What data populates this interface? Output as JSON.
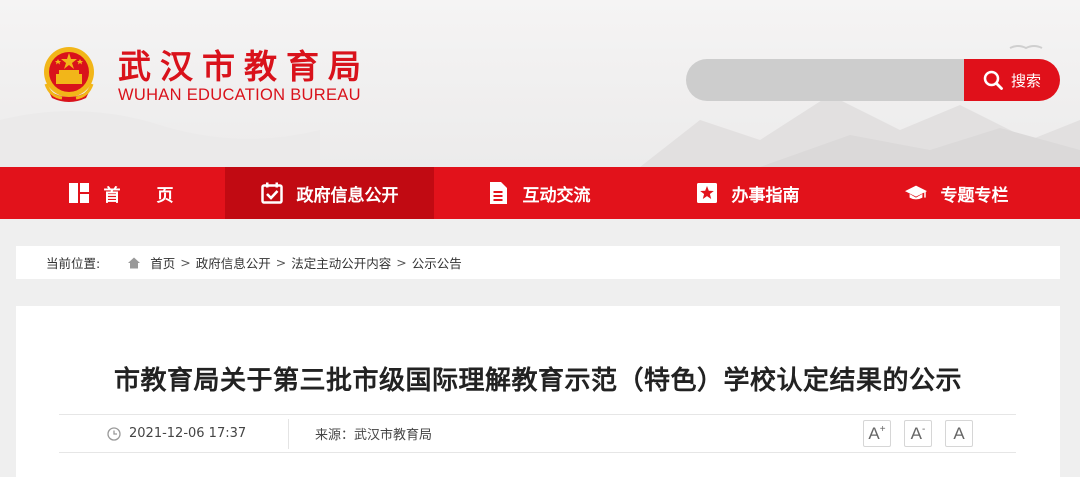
{
  "header": {
    "title": "武汉市教育局",
    "subtitle": "WUHAN EDUCATION BUREAU",
    "emblem": "national-emblem",
    "search": {
      "placeholder": "",
      "button_label": "搜索",
      "icon": "search-icon"
    }
  },
  "nav": {
    "items": [
      {
        "label": "首页",
        "icon": "home-grid-icon",
        "active": false
      },
      {
        "label": "政府信息公开",
        "icon": "calendar-check-icon",
        "active": true
      },
      {
        "label": "互动交流",
        "icon": "document-icon",
        "active": false
      },
      {
        "label": "办事指南",
        "icon": "star-bookmark-icon",
        "active": false
      },
      {
        "label": "专题专栏",
        "icon": "graduation-cap-icon",
        "active": false
      }
    ]
  },
  "breadcrumb": {
    "prefix": "当前位置:",
    "icon": "home-icon",
    "items": [
      "首页",
      "政府信息公开",
      "法定主动公开内容",
      "公示公告"
    ],
    "separator": ">"
  },
  "article": {
    "title": "市教育局关于第三批市级国际理解教育示范（特色）学校认定结果的公示",
    "date": "2021-12-06 17:37",
    "source": "来源：武汉市教育局",
    "font_buttons": [
      {
        "label": "A",
        "mark": "+"
      },
      {
        "label": "A",
        "mark": "-"
      },
      {
        "label": "A",
        "mark": ""
      }
    ]
  },
  "colors": {
    "brand_red": "#e2121b",
    "active_nav": "#c10a12",
    "title_red": "#d9121b"
  }
}
